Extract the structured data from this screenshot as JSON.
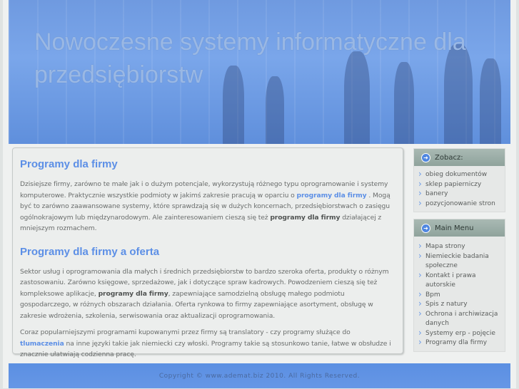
{
  "header": {
    "title": "Nowoczesne systemy informatyczne dla przedsiębiorstw"
  },
  "main": {
    "section1": {
      "heading": "Programy dla firmy",
      "p1_a": "Dzisiejsze firmy, zarówno te małe jak i o dużym potencjale, wykorzystują różnego typu oprogramowanie i systemy komputerowe. Praktycznie wszystkie podmioty w jakimś zakresie pracują w oparciu o ",
      "p1_link": "programy dla firmy",
      "p1_b": " . Mogą być to zarówno zaawansowane systemy, które sprawdzają się w dużych koncernach, przedsiębiorstwach o zasięgu ogólnokrajowym lub międzynarodowym. Ale zainteresowaniem cieszą się też ",
      "p1_bold": "programy dla firmy",
      "p1_c": " działającej z mniejszym rozmachem."
    },
    "section2": {
      "heading": "Programy dla firmy a oferta",
      "p1_a": "Sektor usług i oprogramowania dla małych i średnich przedsiębiorstw to bardzo szeroka oferta, produkty o różnym zastosowaniu. Zarówno księgowe, sprzedażowe, jak i dotyczące spraw kadrowych. Powodzeniem cieszą się też kompleksowe aplikacje, ",
      "p1_bold": "programy dla firmy",
      "p1_b": ", zapewniające samodzielną obsługę małego podmiotu gospodarczego, w różnych obszarach działania. Oferta rynkowa to firmy zapewniające asortyment, obsługę w zakresie wdrożenia, szkolenia, serwisowania oraz aktualizacji oprogramowania.",
      "p2_a": "Coraz popularniejszymi programami kupowanymi przez firmy są translatory - czy programy  służące do ",
      "p2_link": "tlumaczenia",
      "p2_b": " na inne języki takie jak niemiecki czy włoski. Programy takie są stosunkowo tanie, łatwe w obsłudze i znacznie ułatwiają codzienna pracę."
    }
  },
  "sidebar": {
    "zobacz": {
      "title": "Zobacz:",
      "items": [
        "obieg dokumentów",
        "sklep papierniczy",
        "banery",
        "pozycjonowanie stron"
      ]
    },
    "menu": {
      "title": "Main Menu",
      "items": [
        "Mapa strony",
        "Niemieckie badania społeczne",
        "Kontakt i prawa autorskie",
        "Bpm",
        "Spis z natury",
        "Ochrona i archiwizacja danych",
        "Systemy erp - pojęcie",
        "Programy dla firmy"
      ]
    }
  },
  "footer": {
    "copyright": "Copyright © www.ademat.biz 2010. All Rights Reserved."
  }
}
